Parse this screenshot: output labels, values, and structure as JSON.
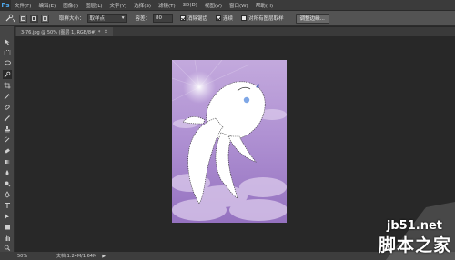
{
  "app": {
    "logo": "Ps"
  },
  "menu": [
    "文件(F)",
    "编辑(E)",
    "图像(I)",
    "图层(L)",
    "文字(Y)",
    "选择(S)",
    "滤镜(T)",
    "3D(D)",
    "视图(V)",
    "窗口(W)",
    "帮助(H)"
  ],
  "options": {
    "tool_icon": "quick-selection-icon",
    "sample_size_label": "取样大小：",
    "sample_size_value": "取样点",
    "tolerance_label": "容差：",
    "tolerance_value": "80",
    "antialias_label": "消除锯齿",
    "antialias_checked": true,
    "contiguous_label": "连续",
    "contiguous_checked": true,
    "all_layers_label": "对所有图层取样",
    "all_layers_checked": false,
    "refine_edge_label": "调整边缘..."
  },
  "document": {
    "tab_title": "3-76.jpg @ 50% (图层 1, RGB/8#) *",
    "close_glyph": "×"
  },
  "toolbar": {
    "tools": [
      "move-icon",
      "marquee-icon",
      "lasso-icon",
      "quick-selection-icon",
      "crop-icon",
      "eyedropper-icon",
      "healing-brush-icon",
      "brush-icon",
      "clone-stamp-icon",
      "history-brush-icon",
      "eraser-icon",
      "gradient-icon",
      "blur-icon",
      "dodge-icon",
      "pen-icon",
      "type-icon",
      "path-selection-icon",
      "shape-icon",
      "hand-icon",
      "zoom-icon"
    ],
    "selected": "quick-selection-icon"
  },
  "status": {
    "zoom": "50%",
    "doc_size": "文档:1.24M/1.64M",
    "arrow": "▶"
  },
  "watermark": {
    "site": "jb51.net",
    "name": "脚本之家"
  },
  "colors": {
    "accent": "#4ea6ea",
    "canvas_bg": "#282828",
    "purple": "#9b7bc4"
  }
}
